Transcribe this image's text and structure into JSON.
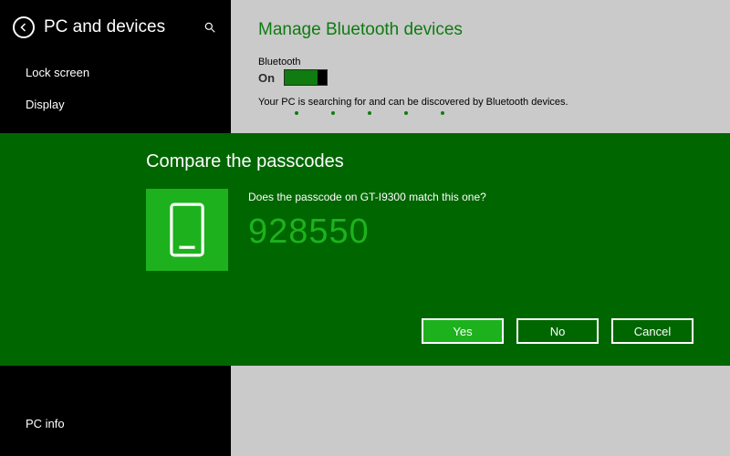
{
  "sidebar": {
    "title": "PC and devices",
    "items": [
      "Lock screen",
      "Display"
    ],
    "last_item": "PC info"
  },
  "main": {
    "title": "Manage Bluetooth devices",
    "bluetooth_label": "Bluetooth",
    "bluetooth_state": "On",
    "description": "Your PC is searching for and can be discovered by Bluetooth devices."
  },
  "modal": {
    "title": "Compare the passcodes",
    "question": "Does the passcode on GT-I9300 match this one?",
    "passcode": "928550",
    "buttons": {
      "yes": "Yes",
      "no": "No",
      "cancel": "Cancel"
    }
  }
}
